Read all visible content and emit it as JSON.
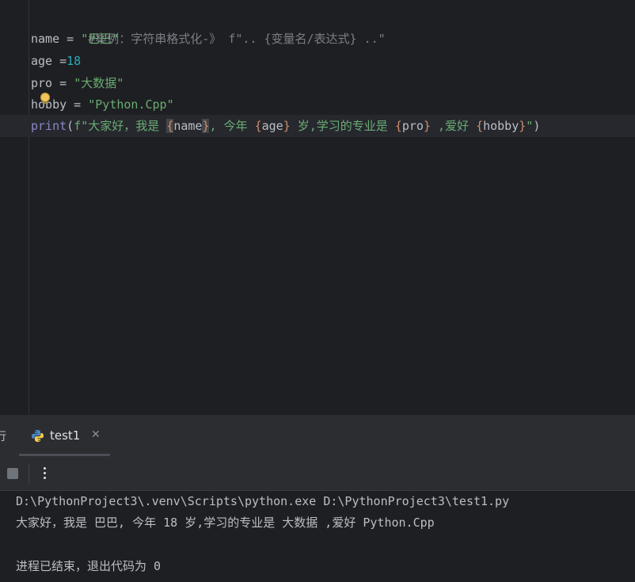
{
  "editor": {
    "lines": {
      "comment": "#案例：字符串格式化-》 f\".. {变量名/表达式} ..\"",
      "name_var": "name",
      "name_op": " = ",
      "name_val": "\"巴巴\"",
      "age_var": "age",
      "age_op": " =",
      "age_val": "18",
      "pro_var": "pro",
      "pro_op": " = ",
      "pro_val": "\"大数据\"",
      "hobby_var": "hobby",
      "hobby_op": " = ",
      "hobby_val": "\"Python.Cpp\"",
      "print_fn": "print",
      "print_open": "(",
      "print_f1": "f\"大家好，我是 ",
      "print_b1": "{",
      "print_v1": "name",
      "print_b2": "}",
      "print_s2": ", 今年 ",
      "print_b3": "{",
      "print_v2": "age",
      "print_b4": "}",
      "print_s3": " 岁,学习的专业是 ",
      "print_b5": "{",
      "print_v3": "pro",
      "print_b6": "}",
      "print_s4": " ,爱好 ",
      "print_b7": "{",
      "print_v4": "hobby",
      "print_b8": "}",
      "print_s5": "\"",
      "print_close": ")"
    }
  },
  "run_panel": {
    "partial_tab_label": "行",
    "tab_label": "test1",
    "close_glyph": "✕"
  },
  "console": {
    "lines": [
      "D:\\PythonProject3\\.venv\\Scripts\\python.exe D:\\PythonProject3\\test1.py",
      "大家好，我是 巴巴, 今年 18 岁,学习的专业是 大数据 ,爱好 Python.Cpp",
      "",
      "进程已结束，退出代码为 0"
    ]
  },
  "colors": {
    "background": "#1e1f22",
    "panel": "#2b2d30",
    "string": "#6aab73",
    "number": "#2aacb8",
    "builtin": "#8888c6",
    "brace": "#cf8e6d",
    "comment": "#7a7e85"
  }
}
